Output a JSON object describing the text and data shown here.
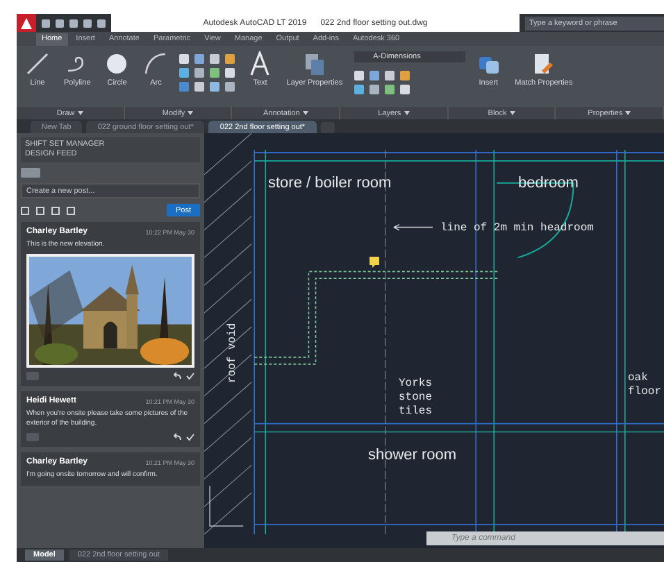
{
  "title_bar": {
    "title": "Autodesk AutoCAD LT 2019",
    "file": "022 2nd floor setting out.dwg",
    "search_placeholder": "Type a keyword or phrase"
  },
  "ribbon_tabs": [
    {
      "label": "Home",
      "selected": true
    },
    {
      "label": "Insert",
      "selected": false
    },
    {
      "label": "Annotate",
      "selected": false
    },
    {
      "label": "Parametric",
      "selected": false
    },
    {
      "label": "View",
      "selected": false
    },
    {
      "label": "Manage",
      "selected": false
    },
    {
      "label": "Output",
      "selected": false
    },
    {
      "label": "Add-ins",
      "selected": false
    },
    {
      "label": "Autodesk 360",
      "selected": false
    }
  ],
  "ribbon_tools": [
    {
      "label": "Line",
      "kind": "line"
    },
    {
      "label": "Polyline",
      "kind": "polyline"
    },
    {
      "label": "Circle",
      "kind": "circle"
    },
    {
      "label": "Arc",
      "kind": "arc"
    },
    {
      "label": "Text",
      "kind": "text"
    },
    {
      "label": "Layer Properties",
      "kind": "layers"
    },
    {
      "label": "Insert",
      "kind": "insert"
    },
    {
      "label": "Match Properties",
      "kind": "match"
    }
  ],
  "layer_dropdown": "A-Dimensions",
  "panel_labels": [
    "Draw",
    "Modify",
    "Annotation",
    "Layers",
    "Block",
    "Properties"
  ],
  "doc_tabs": [
    {
      "label": "New Tab",
      "selected": false
    },
    {
      "label": "022 ground floor setting out*",
      "selected": false
    },
    {
      "label": "022 2nd floor setting out*",
      "selected": true
    }
  ],
  "feed": {
    "header": [
      "SHIFT SET MANAGER",
      "DESIGN FEED"
    ],
    "compose_placeholder": "Create a new post...",
    "post_button": "Post",
    "posts": [
      {
        "author": "Charley Bartley",
        "time": "10:22 PM May 30",
        "text": "This is the new elevation."
      },
      {
        "kind": "text",
        "author": "Heidi Hewett",
        "time": "10:21 PM May 30",
        "text": "When you're onsite please take some pictures of the exterior of the building."
      },
      {
        "kind": "text",
        "author": "Charley Bartley",
        "time": "10:21 PM May 30",
        "text": "I'm going onsite tomorrow and will confirm."
      }
    ]
  },
  "canvas": {
    "labels": [
      {
        "text": "store / boiler room",
        "kind": "room"
      },
      {
        "text": "bedroom",
        "kind": "room"
      },
      {
        "text": "line of 2m min headroom",
        "kind": "callout"
      },
      {
        "text": "roof void",
        "kind": "vertical"
      },
      {
        "text": "Yorks stone tiles",
        "kind": "note"
      },
      {
        "text": "oak floor",
        "kind": "note"
      },
      {
        "text": "shower room",
        "kind": "room"
      }
    ],
    "command_placeholder": "Type a command"
  },
  "status_tabs": [
    {
      "label": "Model",
      "selected": true
    },
    {
      "label": "022 2nd floor setting out",
      "selected": false
    }
  ]
}
